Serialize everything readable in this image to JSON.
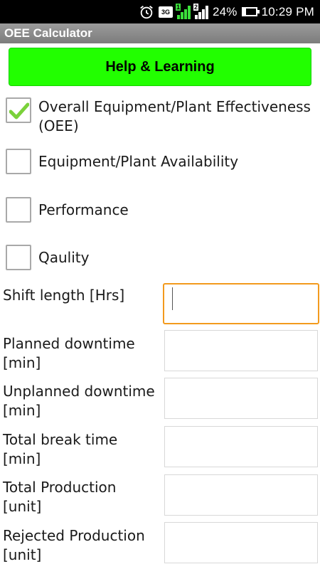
{
  "status_bar": {
    "network": "3G",
    "sim1_tag": "1",
    "sim2_tag": "2",
    "battery": "24%",
    "battery_level": 0.24,
    "time": "10:29 PM",
    "icons": [
      "alarm-icon",
      "network-badge-icon",
      "signal-sim1-icon",
      "signal-sim2-icon",
      "battery-icon"
    ]
  },
  "app": {
    "title": "OEE Calculator"
  },
  "help_button": {
    "label": "Help & Learning",
    "color": "#22ff00"
  },
  "options": [
    {
      "label": "Overall Equipment/Plant Effectiveness (OEE)",
      "checked": true
    },
    {
      "label": "Equipment/Plant Availability",
      "checked": false
    },
    {
      "label": "Performance",
      "checked": false
    },
    {
      "label": "Qaulity",
      "checked": false
    }
  ],
  "fields": [
    {
      "label": "Shift length [Hrs]",
      "value": "",
      "focused": true
    },
    {
      "label": "Planned downtime [min]",
      "value": ""
    },
    {
      "label": "Unplanned downtime [min]",
      "value": ""
    },
    {
      "label": "Total break time [min]",
      "value": ""
    },
    {
      "label": "Total Production [unit]",
      "value": ""
    },
    {
      "label": "Rejected Production [unit]",
      "value": ""
    }
  ],
  "colors": {
    "focus_border": "#f39a1d",
    "check": "#7ad13a"
  }
}
